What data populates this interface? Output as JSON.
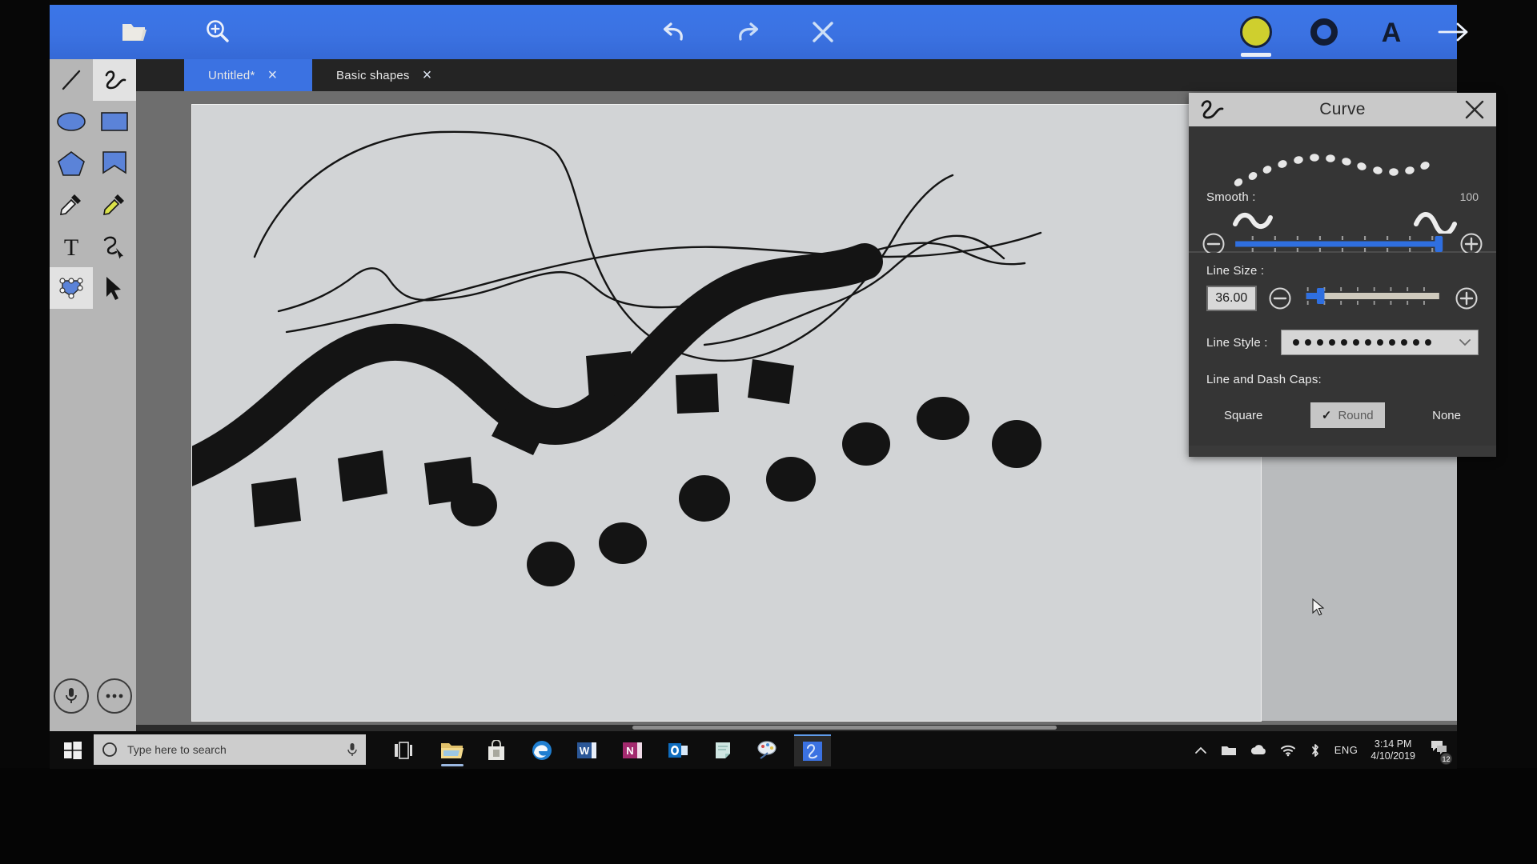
{
  "app": {
    "name": "drawing-app",
    "accent_blue": "#3b72e2",
    "canvas_bg": "#d2d4d6",
    "ink_color": "#121212"
  },
  "commandbar": {
    "items": [
      {
        "name": "open-file-icon",
        "label": "Open"
      },
      {
        "name": "zoom-icon",
        "label": "Zoom"
      },
      {
        "name": "undo-icon",
        "label": "Undo"
      },
      {
        "name": "redo-icon",
        "label": "Redo"
      },
      {
        "name": "close-icon",
        "label": "Close"
      },
      {
        "name": "fill-color-swatch",
        "label": "Fill color"
      },
      {
        "name": "outline-color-icon",
        "label": "Outline"
      },
      {
        "name": "text-color-icon",
        "label": "Text"
      },
      {
        "name": "next-arrow-icon",
        "label": "Next"
      }
    ],
    "fill_color": "#cfcf2e",
    "outline_color": "#16213c"
  },
  "tabs": [
    {
      "label": "Untitled*",
      "active": true,
      "close": "×"
    },
    {
      "label": "Basic shapes",
      "active": false,
      "close": "×"
    }
  ],
  "palette": {
    "tools": [
      {
        "name": "line-tool",
        "label": "Line",
        "selected": false
      },
      {
        "name": "curve-tool",
        "label": "Curve",
        "selected": true
      },
      {
        "name": "ellipse-tool",
        "label": "Ellipse",
        "selected": false
      },
      {
        "name": "rectangle-tool",
        "label": "Rectangle",
        "selected": false
      },
      {
        "name": "polygon-tool",
        "label": "Polygon",
        "selected": false
      },
      {
        "name": "star-tool",
        "label": "Star",
        "selected": false
      },
      {
        "name": "eyedropper-tool",
        "label": "Eyedropper",
        "selected": false
      },
      {
        "name": "fill-eyedropper-tool",
        "label": "Fill picker",
        "selected": false
      },
      {
        "name": "text-tool",
        "label": "Text",
        "selected": false
      },
      {
        "name": "pen-path-tool",
        "label": "Pen",
        "selected": false
      },
      {
        "name": "node-edit-tool",
        "label": "Edit nodes",
        "selected": true
      },
      {
        "name": "select-tool",
        "label": "Select",
        "selected": false
      }
    ],
    "bottom_buttons": [
      {
        "name": "microphone-button",
        "label": "Voice"
      },
      {
        "name": "more-options-button",
        "label": "More"
      }
    ]
  },
  "panel": {
    "title": "Curve",
    "icon": "curve-icon",
    "close": "✕",
    "smooth": {
      "label": "Smooth :",
      "value": "100",
      "value_number": 100,
      "min": 0,
      "max": 100,
      "minus": "−",
      "plus": "+"
    },
    "line_size": {
      "label": "Line Size :",
      "value": "36.00",
      "value_number": 36,
      "percent": 12,
      "minus": "−",
      "plus": "+"
    },
    "line_style": {
      "label": "Line Style :",
      "selected": "dotted",
      "chevron": "⌄"
    },
    "caps": {
      "label": "Line and Dash Caps:",
      "options": [
        {
          "label": "Square",
          "selected": false
        },
        {
          "label": "Round",
          "selected": true,
          "check": "✓"
        },
        {
          "label": "None",
          "selected": false
        }
      ]
    }
  },
  "taskbar": {
    "start": "start-button",
    "search": {
      "placeholder": "Type here to search",
      "mic": "mic-icon"
    },
    "apps": [
      {
        "name": "task-view-icon",
        "label": "Task View",
        "running": false
      },
      {
        "name": "file-explorer-icon",
        "label": "File Explorer",
        "running": true
      },
      {
        "name": "microsoft-store-icon",
        "label": "Store",
        "running": false
      },
      {
        "name": "edge-browser-icon",
        "label": "Microsoft Edge",
        "running": false
      },
      {
        "name": "word-icon",
        "label": "Word",
        "running": false
      },
      {
        "name": "onenote-icon",
        "label": "OneNote",
        "running": false
      },
      {
        "name": "outlook-icon",
        "label": "Outlook",
        "running": false
      },
      {
        "name": "sticky-notes-icon",
        "label": "Sticky Notes",
        "running": false
      },
      {
        "name": "paint-icon",
        "label": "Paint 3D",
        "running": false
      },
      {
        "name": "drawing-app-icon",
        "label": "Drawing app",
        "running": true,
        "active": true
      }
    ],
    "tray": {
      "chevron": "⌃",
      "icons": [
        {
          "name": "network-folder-icon",
          "label": "Network"
        },
        {
          "name": "onedrive-cloud-icon",
          "label": "OneDrive"
        },
        {
          "name": "wifi-icon",
          "label": "Wi-Fi"
        },
        {
          "name": "bluetooth-icon",
          "label": "Bluetooth"
        }
      ],
      "language": "ENG",
      "time": "3:14 PM",
      "date": "4/10/2019",
      "action_center": {
        "name": "action-center-icon",
        "badge": "12"
      }
    }
  }
}
